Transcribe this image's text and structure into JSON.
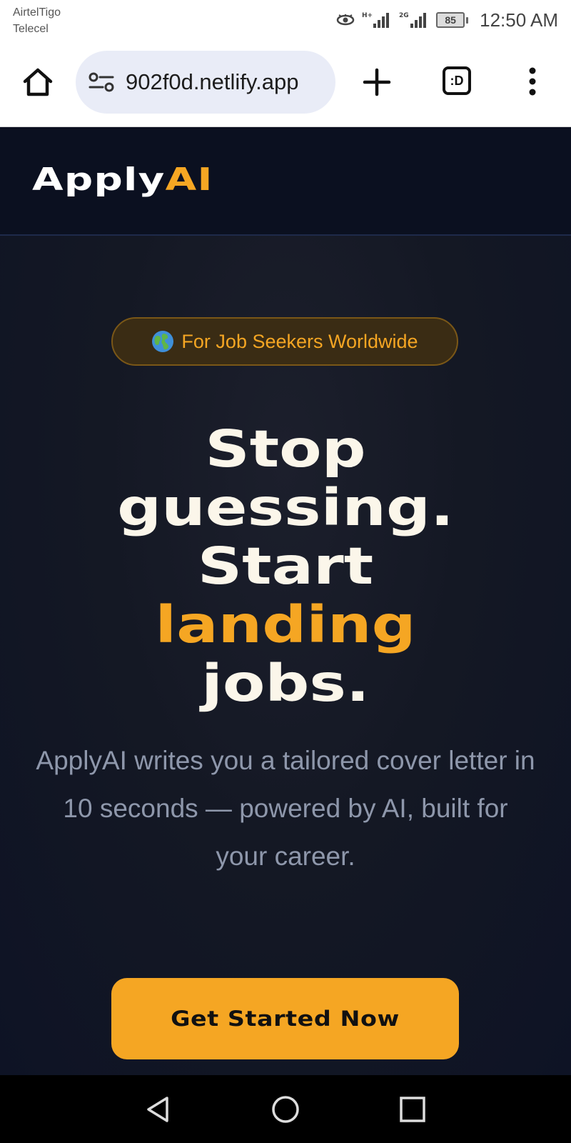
{
  "status_bar": {
    "carrier_line1": "AirtelTigo",
    "carrier_line2": "Telecel",
    "network1": "H+",
    "network2": "2G",
    "battery": "85",
    "time": "12:50 AM"
  },
  "browser": {
    "url": "902f0d.netlify.app",
    "tabs_label": ":D",
    "icons": [
      "home-icon",
      "site-settings-icon",
      "plus-icon",
      "tabs-icon",
      "more-vert-icon"
    ]
  },
  "site": {
    "logo_main": "Apply",
    "logo_accent": "AI",
    "badge_text": "For Job Seekers Worldwide",
    "headline": {
      "line1": "Stop",
      "line2": "guessing.",
      "line3": "Start",
      "line4": "landing",
      "line5": "jobs."
    },
    "subtext": "ApplyAI writes you a tailored cover letter in 10 seconds — powered by AI, built for your career.",
    "cta_label": "Get Started Now"
  },
  "colors": {
    "accent": "#f5a623",
    "background": "#0b0f1f",
    "headline": "#fbf6ea",
    "subtext": "#8e97ab"
  }
}
